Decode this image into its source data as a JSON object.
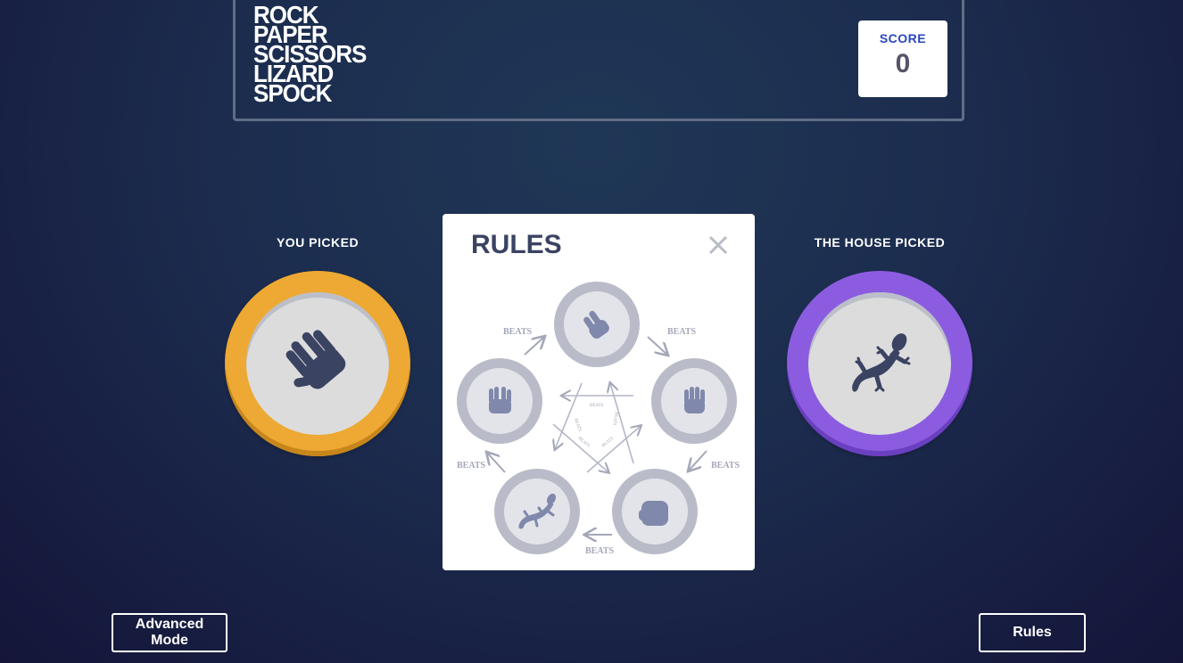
{
  "header": {
    "logo_lines": [
      "ROCK",
      "PAPER",
      "SCISSORS",
      "LIZARD",
      "SPOCK"
    ],
    "score_label": "SCORE",
    "score_value": "0"
  },
  "game": {
    "you_picked_label": "YOU PICKED",
    "house_picked_label": "THE HOUSE PICKED",
    "you_picked_icon": "spock-hand-icon",
    "house_picked_icon": "lizard-icon"
  },
  "rules_modal": {
    "title": "RULES",
    "beats_label": "BEATS"
  },
  "footer": {
    "advanced_mode_label": "Advanced Mode",
    "rules_label": "Rules"
  },
  "colors": {
    "spock_ring": "#eda933",
    "lizard_ring": "#8c5ce0",
    "score_label": "#2a46c0",
    "icon_dark": "#3b4363"
  }
}
